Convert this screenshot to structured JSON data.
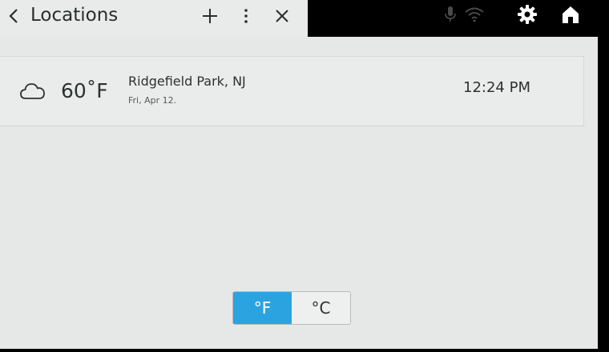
{
  "header": {
    "title": "Locations",
    "back_icon": "chevron-left-icon",
    "add_icon": "plus-icon",
    "more_icon": "more-vertical-icon",
    "close_icon": "close-icon"
  },
  "status_bar": {
    "icons": [
      "microphone-icon",
      "wifi-icon",
      "gear-icon",
      "home-icon"
    ]
  },
  "location": {
    "weather_icon": "cloud-icon",
    "temperature": "60˚F",
    "city": "Ridgefield Park, NJ",
    "date": "Fri, Apr 12.",
    "time": "12:24 PM"
  },
  "units": {
    "fahrenheit_label": "°F",
    "celsius_label": "°C",
    "selected": "fahrenheit"
  },
  "colors": {
    "accent": "#2ba3e0",
    "background": "#e6e8e7",
    "topbar": "#000000"
  }
}
